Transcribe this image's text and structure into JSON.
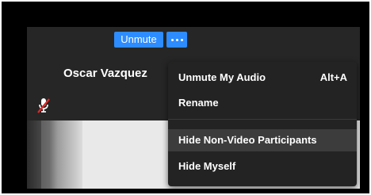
{
  "tile": {
    "unmute_button_label": "Unmute",
    "more_button_icon": "ellipsis-icon",
    "participant_name": "Oscar Vazquez",
    "mic_status_icon": "muted-microphone-icon"
  },
  "menu": {
    "items": [
      {
        "label": "Unmute My Audio",
        "shortcut": "Alt+A"
      },
      {
        "label": "Rename",
        "shortcut": ""
      },
      {
        "label": "Hide Non-Video Participants",
        "shortcut": ""
      },
      {
        "label": "Hide Myself",
        "shortcut": ""
      }
    ]
  },
  "colors": {
    "accent_blue": "#2d8cff",
    "tile_background": "#262626",
    "menu_background": "#232323",
    "menu_highlight": "#3c3c3c",
    "mute_slash": "#e02828"
  }
}
